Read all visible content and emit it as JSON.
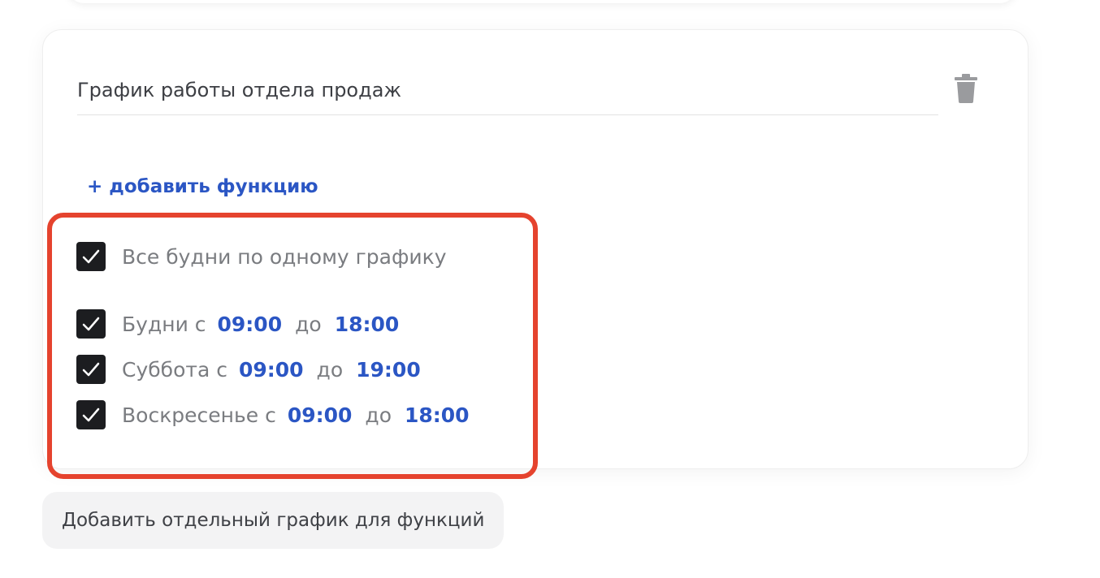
{
  "schedule_card": {
    "name": "График работы отдела продаж",
    "add_function_label": "+ добавить функцию",
    "trash_icon": "trash-icon"
  },
  "schedule": {
    "same_weekdays_label": "Все будни по одному графику",
    "same_weekdays_checked": true,
    "days": [
      {
        "label": "Будни с",
        "from": "09:00",
        "to_label": "до",
        "to": "18:00",
        "checked": true
      },
      {
        "label": "Суббота с",
        "from": "09:00",
        "to_label": "до",
        "to": "19:00",
        "checked": true
      },
      {
        "label": "Воскресенье с",
        "from": "09:00",
        "to_label": "до",
        "to": "18:00",
        "checked": true
      }
    ]
  },
  "actions": {
    "add_separate_schedule": "Добавить отдельный график для функций"
  },
  "colors": {
    "accent": "#2b56c4",
    "highlight": "#e5432e",
    "checkbox": "#1c1d20"
  }
}
